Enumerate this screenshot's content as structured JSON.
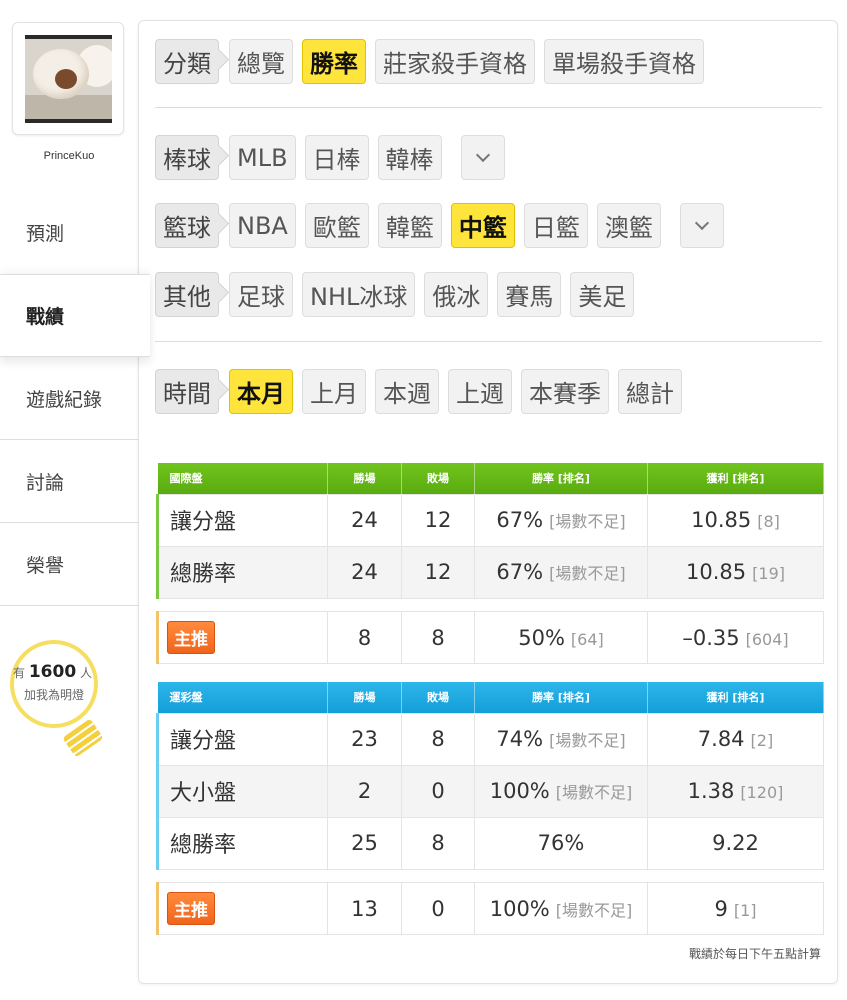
{
  "user": {
    "name": "PrinceKuo"
  },
  "nav": [
    "預測",
    "戰績",
    "遊戲紀錄",
    "討論",
    "榮譽"
  ],
  "fans": {
    "prefix": "有",
    "count": "1600",
    "suffix": "人",
    "line2": "加我為明燈"
  },
  "filters": {
    "category": {
      "label": "分類",
      "options": [
        "總覽",
        "勝率",
        "莊家殺手資格",
        "單場殺手資格"
      ],
      "selected": "勝率"
    },
    "baseball": {
      "label": "棒球",
      "options": [
        "MLB",
        "日棒",
        "韓棒"
      ]
    },
    "basketball": {
      "label": "籃球",
      "options": [
        "NBA",
        "歐籃",
        "韓籃",
        "中籃",
        "日籃",
        "澳籃"
      ],
      "selected": "中籃"
    },
    "other": {
      "label": "其他",
      "options": [
        "足球",
        "NHL冰球",
        "俄冰",
        "賽馬",
        "美足"
      ]
    },
    "time": {
      "label": "時間",
      "options": [
        "本月",
        "上月",
        "本週",
        "上週",
        "本賽季",
        "總計"
      ],
      "selected": "本月"
    }
  },
  "intl": {
    "headers": [
      "國際盤",
      "勝場",
      "敗場",
      "勝率 [排名]",
      "獲利 [排名]"
    ],
    "rows": [
      {
        "name": "讓分盤",
        "win": "24",
        "lose": "12",
        "rate": "67%",
        "rate_rank": "[場數不足]",
        "profit": "10.85",
        "profit_rank": "[8]"
      },
      {
        "name": "總勝率",
        "win": "24",
        "lose": "12",
        "rate": "67%",
        "rate_rank": "[場數不足]",
        "profit": "10.85",
        "profit_rank": "[19]"
      }
    ],
    "featured": {
      "badge": "主推",
      "win": "8",
      "lose": "8",
      "rate": "50%",
      "rate_rank": "[64]",
      "profit": "–0.35",
      "profit_rank": "[604]"
    }
  },
  "lottery": {
    "headers": [
      "運彩盤",
      "勝場",
      "敗場",
      "勝率 [排名]",
      "獲利 [排名]"
    ],
    "rows": [
      {
        "name": "讓分盤",
        "win": "23",
        "lose": "8",
        "rate": "74%",
        "rate_rank": "[場數不足]",
        "profit": "7.84",
        "profit_rank": "[2]"
      },
      {
        "name": "大小盤",
        "win": "2",
        "lose": "0",
        "rate": "100%",
        "rate_rank": "[場數不足]",
        "profit": "1.38",
        "profit_rank": "[120]"
      },
      {
        "name": "總勝率",
        "win": "25",
        "lose": "8",
        "rate": "76%",
        "rate_rank": "",
        "profit": "9.22",
        "profit_rank": ""
      }
    ],
    "featured": {
      "badge": "主推",
      "win": "13",
      "lose": "0",
      "rate": "100%",
      "rate_rank": "[場數不足]",
      "profit": "9",
      "profit_rank": "[1]"
    }
  },
  "footnote": "戰績於每日下午五點計算"
}
